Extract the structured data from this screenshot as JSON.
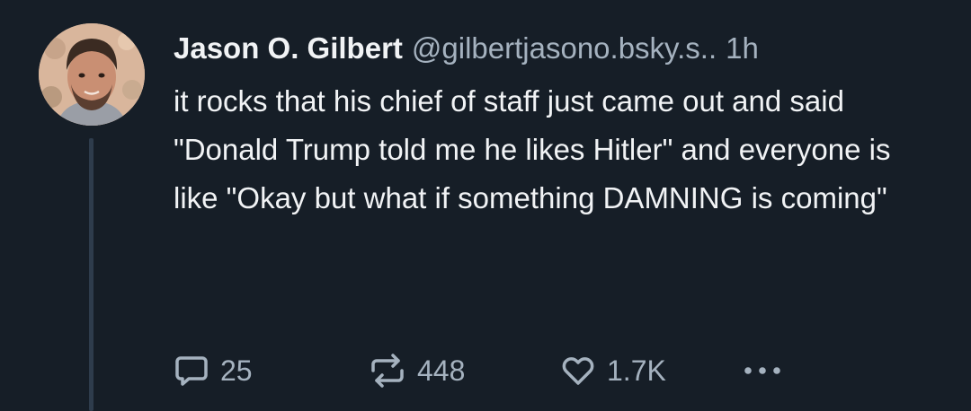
{
  "post": {
    "author": {
      "display_name": "Jason O. Gilbert",
      "handle": "@gilbertjasono.bsky.s..",
      "timestamp": "1h"
    },
    "text": "it rocks that his chief of staff just came out and said \"Donald Trump told me he likes Hitler\" and everyone is like \"Okay but what if something DAMNING is coming\"",
    "actions": {
      "reply": {
        "icon": "speech-bubble-icon",
        "count": "25"
      },
      "repost": {
        "icon": "repost-arrows-icon",
        "count": "448"
      },
      "like": {
        "icon": "heart-icon",
        "count": "1.7K"
      },
      "more": {
        "icon": "ellipsis-icon"
      }
    }
  },
  "colors": {
    "background": "#161e27",
    "text": "#f1f3f5",
    "muted": "#a5b2bf",
    "thread_line": "#2e3c4c"
  }
}
